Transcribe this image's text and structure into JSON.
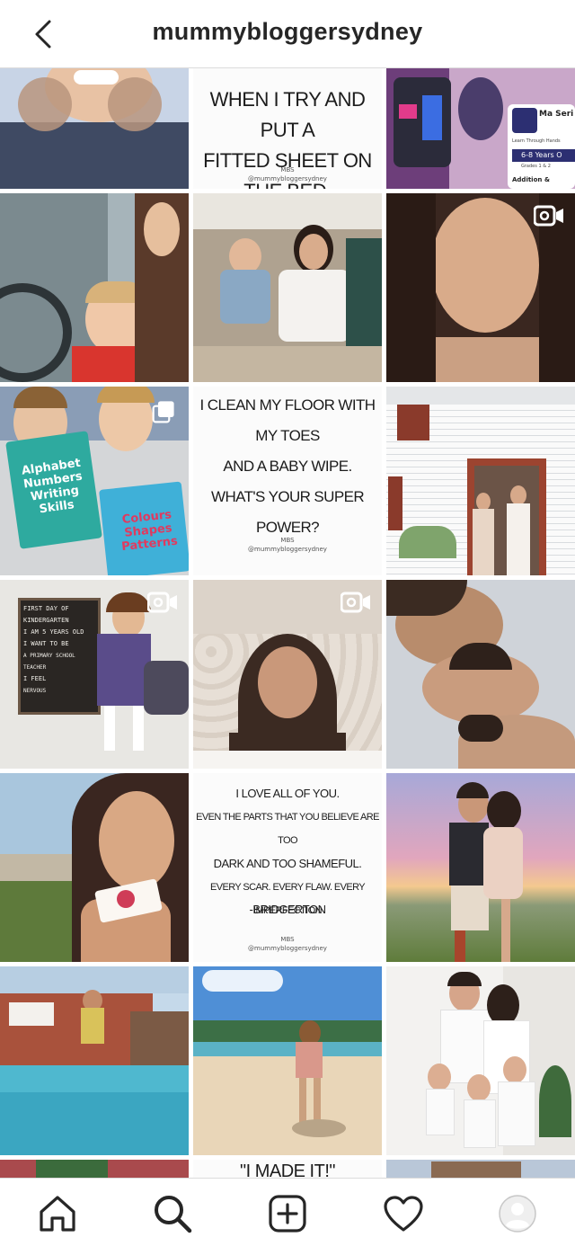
{
  "header": {
    "username": "mummybloggersydney"
  },
  "posts": {
    "p2": {
      "lines": [
        "WHEN I TRY AND PUT A",
        "FITTED SHEET ON THE BED."
      ],
      "signature": "MBS",
      "handle": "@mummybloggersydney"
    },
    "p3": {
      "badge_title": "Ma Seri",
      "badge_sub": "Learn Through Hands",
      "badge_age": "6-8 Years O",
      "badge_grade": "Grades 1 & 2",
      "badge_topic": "Addition &"
    },
    "p7": {
      "book1_title": "Alphabet Numbers Writing Skills",
      "book2_title": "Colours Shapes Patterns"
    },
    "p8": {
      "lines": [
        "I CLEAN MY FLOOR WITH MY TOES",
        "AND A BABY WIPE.",
        "WHAT'S YOUR SUPER POWER?"
      ],
      "signature": "MBS",
      "handle": "@mummybloggersydney"
    },
    "p10": {
      "board_lines": [
        "FIRST DAY OF",
        "KINDERGARTEN",
        "I AM 5 YEARS OLD",
        "I WANT TO BE",
        "A PRIMARY SCHOOL TEACHER",
        "I FEEL",
        "NERVOUS"
      ]
    },
    "p14": {
      "lines": [
        "I LOVE ALL OF YOU.",
        "EVEN THE PARTS THAT YOU BELIEVE ARE TOO",
        "DARK AND TOO SHAMEFUL.",
        "EVERY SCAR. EVERY FLAW. EVERY IMPERFECTION",
        "-BRIDGERTON"
      ],
      "signature": "MBS",
      "handle": "@mummybloggersydney"
    },
    "p20": {
      "lines": [
        "\"I MADE IT!\""
      ]
    }
  },
  "nav": {
    "items": [
      "home-icon",
      "search-icon",
      "add-post-icon",
      "activity-icon",
      "profile-avatar"
    ]
  },
  "colors": {
    "border": "#dbdbdb",
    "text": "#262626",
    "icon": "#262626"
  }
}
